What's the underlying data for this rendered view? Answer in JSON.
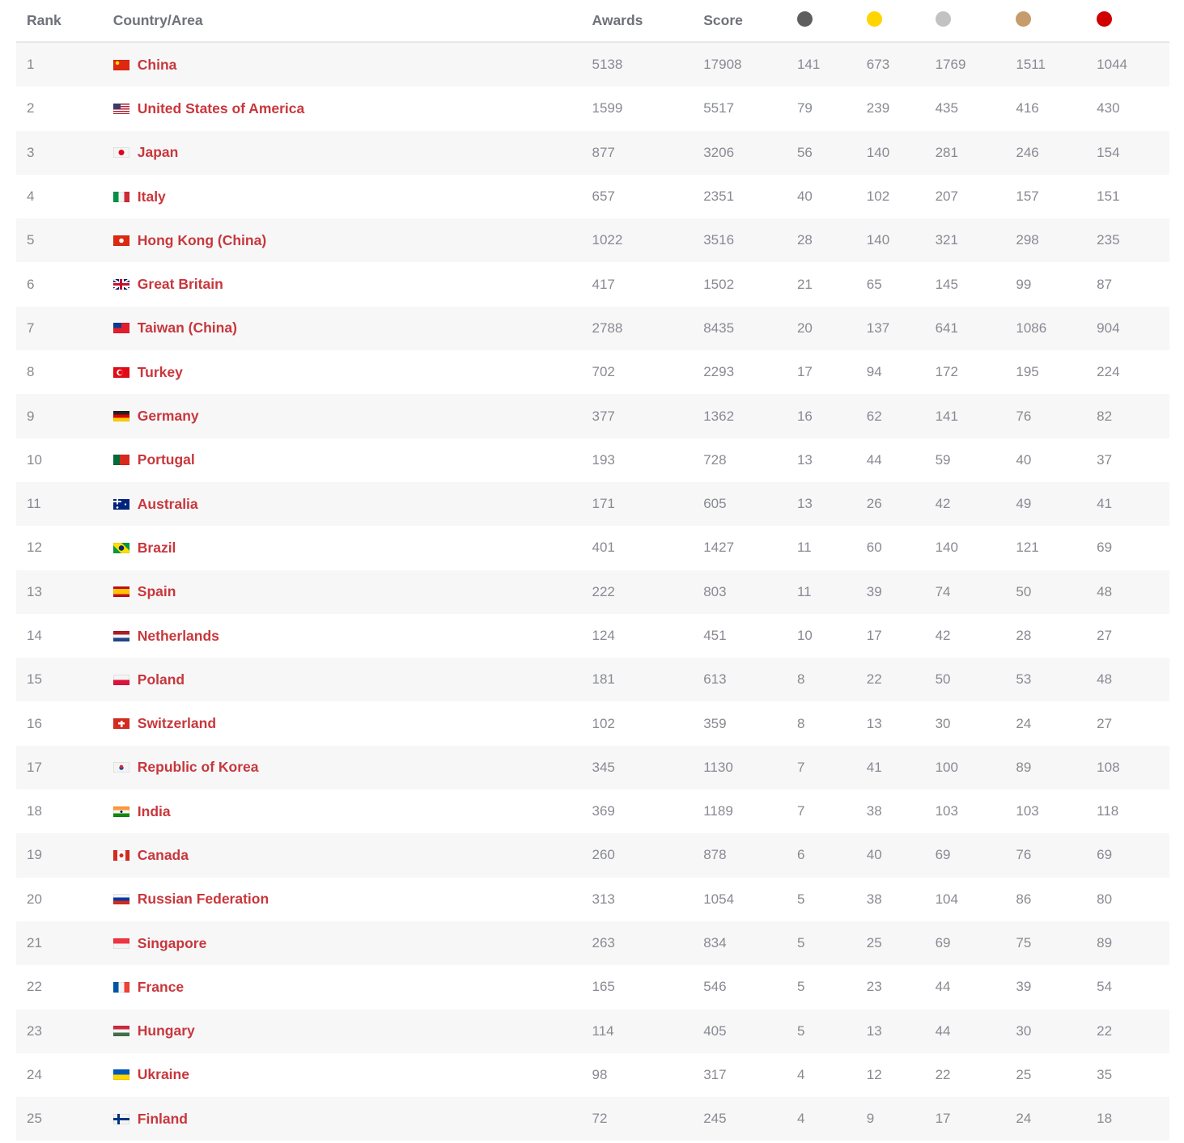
{
  "header": {
    "rank": "Rank",
    "country": "Country/Area",
    "awards": "Awards",
    "score": "Score",
    "medal_columns": [
      {
        "icon": "dark-gray-medal-dot",
        "color": "#5e5e5e"
      },
      {
        "icon": "gold-medal-dot",
        "color": "#ffd400"
      },
      {
        "icon": "silver-medal-dot",
        "color": "#c2c2c2"
      },
      {
        "icon": "bronze-medal-dot",
        "color": "#c69c6d"
      },
      {
        "icon": "red-medal-dot",
        "color": "#d00000"
      }
    ]
  },
  "colors": {
    "country_link": "#c8373c",
    "text_muted": "#888a91",
    "header_text": "#6f717a",
    "stripe": "#f7f7f8"
  },
  "rows": [
    {
      "rank": "1",
      "country": "China",
      "flag": "china",
      "awards": "5138",
      "score": "17908",
      "m": [
        "141",
        "673",
        "1769",
        "1511",
        "1044"
      ]
    },
    {
      "rank": "2",
      "country": "United States of America",
      "flag": "usa",
      "awards": "1599",
      "score": "5517",
      "m": [
        "79",
        "239",
        "435",
        "416",
        "430"
      ]
    },
    {
      "rank": "3",
      "country": "Japan",
      "flag": "japan",
      "awards": "877",
      "score": "3206",
      "m": [
        "56",
        "140",
        "281",
        "246",
        "154"
      ]
    },
    {
      "rank": "4",
      "country": "Italy",
      "flag": "italy",
      "awards": "657",
      "score": "2351",
      "m": [
        "40",
        "102",
        "207",
        "157",
        "151"
      ]
    },
    {
      "rank": "5",
      "country": "Hong Kong (China)",
      "flag": "hongkong",
      "awards": "1022",
      "score": "3516",
      "m": [
        "28",
        "140",
        "321",
        "298",
        "235"
      ]
    },
    {
      "rank": "6",
      "country": "Great Britain",
      "flag": "gb",
      "awards": "417",
      "score": "1502",
      "m": [
        "21",
        "65",
        "145",
        "99",
        "87"
      ]
    },
    {
      "rank": "7",
      "country": "Taiwan (China)",
      "flag": "taiwan",
      "awards": "2788",
      "score": "8435",
      "m": [
        "20",
        "137",
        "641",
        "1086",
        "904"
      ]
    },
    {
      "rank": "8",
      "country": "Turkey",
      "flag": "turkey",
      "awards": "702",
      "score": "2293",
      "m": [
        "17",
        "94",
        "172",
        "195",
        "224"
      ]
    },
    {
      "rank": "9",
      "country": "Germany",
      "flag": "germany",
      "awards": "377",
      "score": "1362",
      "m": [
        "16",
        "62",
        "141",
        "76",
        "82"
      ]
    },
    {
      "rank": "10",
      "country": "Portugal",
      "flag": "portugal",
      "awards": "193",
      "score": "728",
      "m": [
        "13",
        "44",
        "59",
        "40",
        "37"
      ]
    },
    {
      "rank": "11",
      "country": "Australia",
      "flag": "australia",
      "awards": "171",
      "score": "605",
      "m": [
        "13",
        "26",
        "42",
        "49",
        "41"
      ]
    },
    {
      "rank": "12",
      "country": "Brazil",
      "flag": "brazil",
      "awards": "401",
      "score": "1427",
      "m": [
        "11",
        "60",
        "140",
        "121",
        "69"
      ]
    },
    {
      "rank": "13",
      "country": "Spain",
      "flag": "spain",
      "awards": "222",
      "score": "803",
      "m": [
        "11",
        "39",
        "74",
        "50",
        "48"
      ]
    },
    {
      "rank": "14",
      "country": "Netherlands",
      "flag": "netherlands",
      "awards": "124",
      "score": "451",
      "m": [
        "10",
        "17",
        "42",
        "28",
        "27"
      ]
    },
    {
      "rank": "15",
      "country": "Poland",
      "flag": "poland",
      "awards": "181",
      "score": "613",
      "m": [
        "8",
        "22",
        "50",
        "53",
        "48"
      ]
    },
    {
      "rank": "16",
      "country": "Switzerland",
      "flag": "switzerland",
      "awards": "102",
      "score": "359",
      "m": [
        "8",
        "13",
        "30",
        "24",
        "27"
      ]
    },
    {
      "rank": "17",
      "country": "Republic of Korea",
      "flag": "korea",
      "awards": "345",
      "score": "1130",
      "m": [
        "7",
        "41",
        "100",
        "89",
        "108"
      ]
    },
    {
      "rank": "18",
      "country": "India",
      "flag": "india",
      "awards": "369",
      "score": "1189",
      "m": [
        "7",
        "38",
        "103",
        "103",
        "118"
      ]
    },
    {
      "rank": "19",
      "country": "Canada",
      "flag": "canada",
      "awards": "260",
      "score": "878",
      "m": [
        "6",
        "40",
        "69",
        "76",
        "69"
      ]
    },
    {
      "rank": "20",
      "country": "Russian Federation",
      "flag": "russia",
      "awards": "313",
      "score": "1054",
      "m": [
        "5",
        "38",
        "104",
        "86",
        "80"
      ]
    },
    {
      "rank": "21",
      "country": "Singapore",
      "flag": "singapore",
      "awards": "263",
      "score": "834",
      "m": [
        "5",
        "25",
        "69",
        "75",
        "89"
      ]
    },
    {
      "rank": "22",
      "country": "France",
      "flag": "france",
      "awards": "165",
      "score": "546",
      "m": [
        "5",
        "23",
        "44",
        "39",
        "54"
      ]
    },
    {
      "rank": "23",
      "country": "Hungary",
      "flag": "hungary",
      "awards": "114",
      "score": "405",
      "m": [
        "5",
        "13",
        "44",
        "30",
        "22"
      ]
    },
    {
      "rank": "24",
      "country": "Ukraine",
      "flag": "ukraine",
      "awards": "98",
      "score": "317",
      "m": [
        "4",
        "12",
        "22",
        "25",
        "35"
      ]
    },
    {
      "rank": "25",
      "country": "Finland",
      "flag": "finland",
      "awards": "72",
      "score": "245",
      "m": [
        "4",
        "9",
        "17",
        "24",
        "18"
      ]
    }
  ]
}
